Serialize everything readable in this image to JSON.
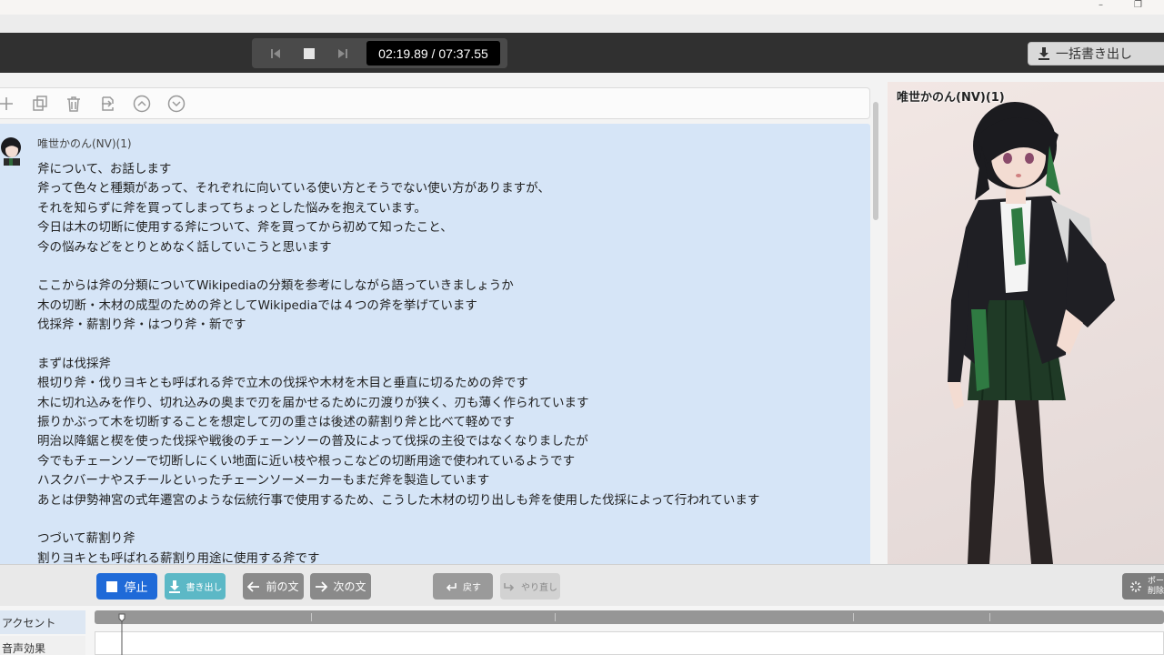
{
  "window": {
    "minimize_glyph": "–",
    "restore_glyph": "❐"
  },
  "toolbar": {
    "current_time": "02:19.89",
    "total_time": "/ 07:37.55",
    "export_all_label": "一括書き出し",
    "icons": [
      "skip-previous-icon",
      "stop-icon",
      "skip-next-icon",
      "download-icon"
    ]
  },
  "editor_icons": [
    "add-icon",
    "copy-icon",
    "trash-icon",
    "replace-icon",
    "chevron-up-circle-icon",
    "chevron-down-circle-icon"
  ],
  "editor": {
    "speaker": "唯世かのん(NV)(1)",
    "lines": [
      "斧について、お話します",
      "斧って色々と種類があって、それぞれに向いている使い方とそうでない使い方がありますが、",
      "それを知らずに斧を買ってしまってちょっとした悩みを抱えています。",
      "今日は木の切断に使用する斧について、斧を買ってから初めて知ったこと、",
      "今の悩みなどをとりとめなく話していこうと思います",
      "",
      "ここからは斧の分類についてWikipediaの分類を参考にしながら語っていきましょうか",
      "木の切断・木材の成型のための斧としてWikipediaでは４つの斧を挙げています",
      "伐採斧・薪割り斧・はつり斧・新です",
      "",
      "まずは伐採斧",
      "根切り斧・伐りヨキとも呼ばれる斧で立木の伐採や木材を木目と垂直に切るための斧です",
      "木に切れ込みを作り、切れ込みの奥まで刃を届かせるために刃渡りが狭く、刃も薄く作られています",
      "振りかぶって木を切断することを想定して刃の重さは後述の薪割り斧と比べて軽めです",
      "明治以降鋸と楔を使った伐採や戦後のチェーンソーの普及によって伐採の主役ではなくなりましたが",
      "今でもチェーンソーで切断しにくい地面に近い枝や根っこなどの切断用途で使われているようです",
      "ハスクバーナやスチールといったチェーンソーメーカーもまだ斧を製造しています",
      "あとは伊勢神宮の式年遷宮のような伝統行事で使用するため、こうした木材の切り出しも斧を使用した伐採によって行われています",
      "",
      "つづいて薪割り斧",
      "割りヨキとも呼ばれる薪割り用途に使用する斧です"
    ]
  },
  "character": {
    "name": "唯世かのん(NV)(1)"
  },
  "bottom": {
    "stop_label": "停止",
    "write_label": "書き出し",
    "prev_label": "前の文",
    "next_label": "次の文",
    "undo_label": "戻す",
    "redo_label": "やり直し",
    "pause_line1": "ポー",
    "pause_line2": "削除"
  },
  "tabs": {
    "accent": "アクセント",
    "sound_effect": "音声効果"
  },
  "colors": {
    "stop_button": "#1f6ad8",
    "write_button": "#5cb8c6",
    "text_panel": "#d6e5f7",
    "toolbar": "#303030"
  }
}
